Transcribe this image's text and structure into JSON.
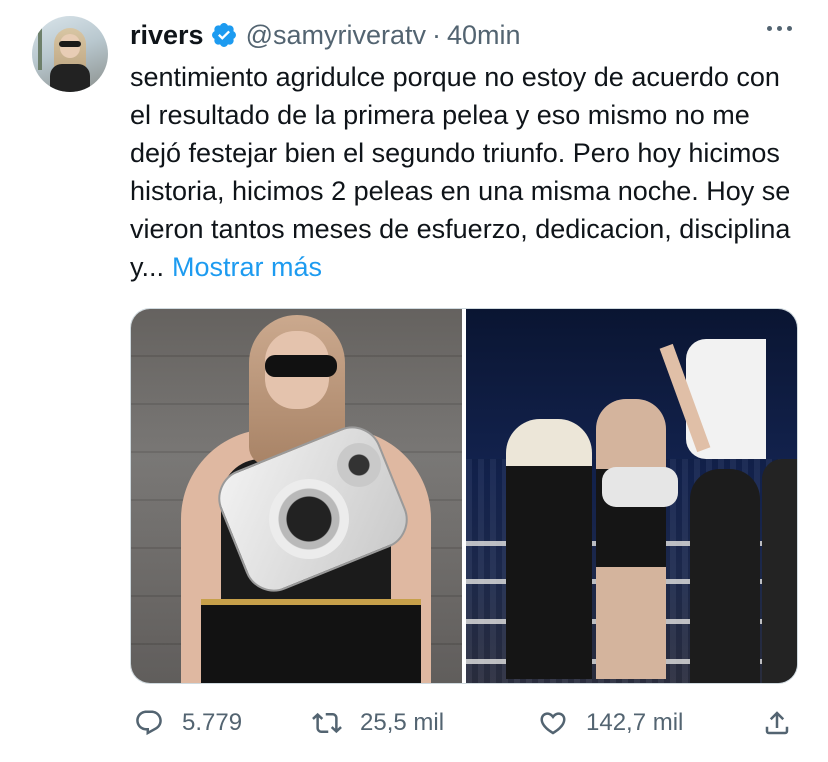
{
  "tweet": {
    "display_name": "rivers",
    "handle": "@samyriveratv",
    "separator": "·",
    "time": "40min",
    "text": "sentimiento agridulce porque no estoy de acuerdo con el resultado de la primera pelea y eso mismo no me dejó festejar bien el segundo triunfo. Pero hoy hicimos historia, hicimos 2 peleas en una misma noche. Hoy se vieron tantos meses de esfuerzo, dedicacion, disciplina y...",
    "show_more": "Mostrar más",
    "verified_color": "#1d9bf0"
  },
  "media": {
    "count": 2,
    "photos": [
      {
        "alt": "boxer with championship belt"
      },
      {
        "alt": "referee raising winner's arm in ring"
      }
    ]
  },
  "actions": {
    "replies": "5.779",
    "retweets": "25,5 mil",
    "likes": "142,7 mil",
    "icons": [
      "reply-icon",
      "retweet-icon",
      "like-icon",
      "share-icon"
    ]
  },
  "colors": {
    "text": "#0f1419",
    "secondary": "#536471",
    "link": "#1d9bf0"
  }
}
